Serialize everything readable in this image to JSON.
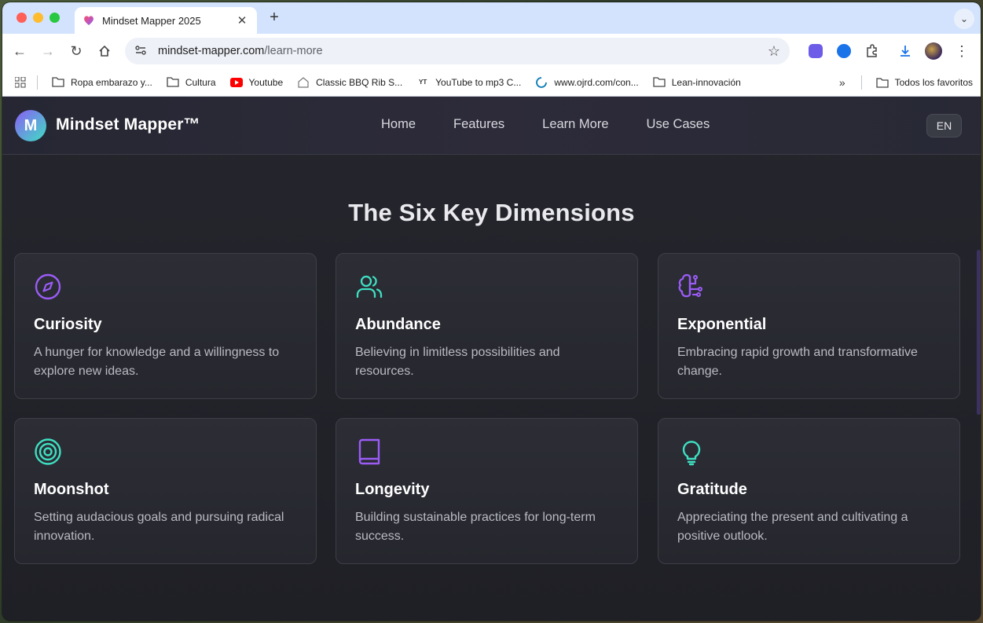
{
  "browser": {
    "tab_title": "Mindset Mapper 2025",
    "url_host": "mindset-mapper.com",
    "url_path": "/learn-more",
    "bookmarks": [
      {
        "label": "Ropa embarazo y...",
        "icon": "folder-icon"
      },
      {
        "label": "Cultura",
        "icon": "folder-icon"
      },
      {
        "label": "Youtube",
        "icon": "youtube-icon"
      },
      {
        "label": "Classic BBQ Rib S...",
        "icon": "site-icon"
      },
      {
        "label": "YouTube to mp3 C...",
        "icon": "mp3-icon"
      },
      {
        "label": "www.ojrd.com/con...",
        "icon": "loading-icon"
      },
      {
        "label": "Lean-innovación",
        "icon": "folder-icon"
      }
    ],
    "all_bookmarks_label": "Todos los favoritos"
  },
  "site": {
    "logo_letter": "M",
    "brand": "Mindset Mapper™",
    "nav": [
      "Home",
      "Features",
      "Learn More",
      "Use Cases"
    ],
    "lang": "EN",
    "colors": {
      "purple": "#8b5cf6",
      "teal": "#3ee0c2"
    }
  },
  "section": {
    "title": "The Six Key Dimensions",
    "cards": [
      {
        "title": "Curiosity",
        "desc": "A hunger for knowledge and a willingness to explore new ideas.",
        "icon": "compass-icon",
        "color": "#9b5cf6"
      },
      {
        "title": "Abundance",
        "desc": "Believing in limitless possibilities and resources.",
        "icon": "users-icon",
        "color": "#3ee0c2"
      },
      {
        "title": "Exponential",
        "desc": "Embracing rapid growth and transformative change.",
        "icon": "brain-icon",
        "color": "#9b5cf6"
      },
      {
        "title": "Moonshot",
        "desc": "Setting audacious goals and pursuing radical innovation.",
        "icon": "target-icon",
        "color": "#3ee0c2"
      },
      {
        "title": "Longevity",
        "desc": "Building sustainable practices for long-term success.",
        "icon": "book-icon",
        "color": "#9b5cf6"
      },
      {
        "title": "Gratitude",
        "desc": "Appreciating the present and cultivating a positive outlook.",
        "icon": "lightbulb-icon",
        "color": "#3ee0c2"
      }
    ]
  }
}
